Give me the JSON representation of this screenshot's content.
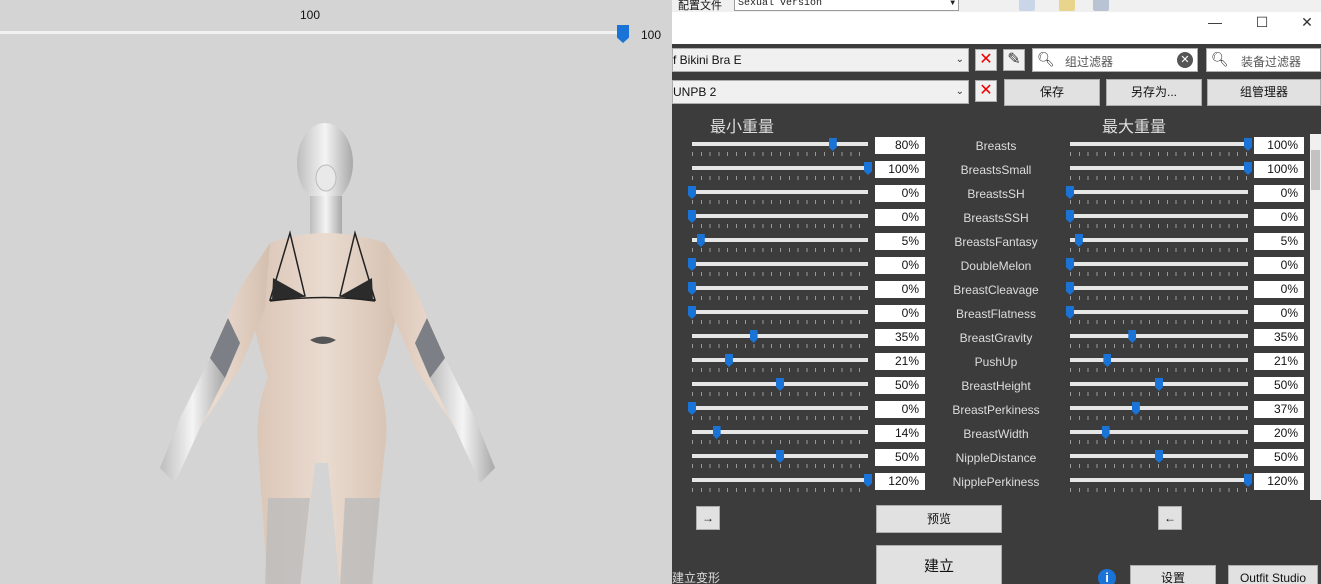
{
  "viewport": {
    "top_value": "100",
    "slider_value": "100"
  },
  "menubar": {
    "menu_label": "配置文件",
    "preset_value": "Sexual version"
  },
  "window_controls": {
    "minimize": "—",
    "maximize": "☐",
    "close": "✕"
  },
  "toolbar": {
    "outfit_value": "f Bikini Bra E",
    "body_value": "UNPB 2",
    "group_filter_placeholder": "组过滤器",
    "outfit_filter_placeholder": "装备过滤器",
    "save_label": "保存",
    "save_as_label": "另存为...",
    "group_manager_label": "组管理器"
  },
  "columns": {
    "min_weight": "最小重量",
    "max_weight": "最大重量"
  },
  "sliders": [
    {
      "name": "Breasts",
      "min": 80,
      "max": 100,
      "min_label": "80%",
      "max_label": "100%"
    },
    {
      "name": "BreastsSmall",
      "min": 100,
      "max": 100,
      "min_label": "100%",
      "max_label": "100%"
    },
    {
      "name": "BreastsSH",
      "min": 0,
      "max": 0,
      "min_label": "0%",
      "max_label": "0%"
    },
    {
      "name": "BreastsSSH",
      "min": 0,
      "max": 0,
      "min_label": "0%",
      "max_label": "0%"
    },
    {
      "name": "BreastsFantasy",
      "min": 5,
      "max": 5,
      "min_label": "5%",
      "max_label": "5%"
    },
    {
      "name": "DoubleMelon",
      "min": 0,
      "max": 0,
      "min_label": "0%",
      "max_label": "0%"
    },
    {
      "name": "BreastCleavage",
      "min": 0,
      "max": 0,
      "min_label": "0%",
      "max_label": "0%"
    },
    {
      "name": "BreastFlatness",
      "min": 0,
      "max": 0,
      "min_label": "0%",
      "max_label": "0%"
    },
    {
      "name": "BreastGravity",
      "min": 35,
      "max": 35,
      "min_label": "35%",
      "max_label": "35%"
    },
    {
      "name": "PushUp",
      "min": 21,
      "max": 21,
      "min_label": "21%",
      "max_label": "21%"
    },
    {
      "name": "BreastHeight",
      "min": 50,
      "max": 50,
      "min_label": "50%",
      "max_label": "50%"
    },
    {
      "name": "BreastPerkiness",
      "min": 0,
      "max": 37,
      "min_label": "0%",
      "max_label": "37%"
    },
    {
      "name": "BreastWidth",
      "min": 14,
      "max": 20,
      "min_label": "14%",
      "max_label": "20%"
    },
    {
      "name": "NippleDistance",
      "min": 50,
      "max": 50,
      "min_label": "50%",
      "max_label": "50%"
    },
    {
      "name": "NipplePerkiness",
      "min": 100,
      "max": 100,
      "min_label": "120%",
      "max_label": "120%"
    }
  ],
  "bottom": {
    "copy_right_label": "→",
    "copy_left_label": "←",
    "preview_label": "预览",
    "build_label": "建立",
    "build_morphs_label": "建立变形",
    "info_label": "i",
    "settings_label": "设置",
    "outfit_studio_label": "Outfit Studio"
  },
  "colors": {
    "accent": "#1a73d6",
    "panel_bg": "#3c3c3c",
    "viewport_bg": "#d4d4d4"
  }
}
